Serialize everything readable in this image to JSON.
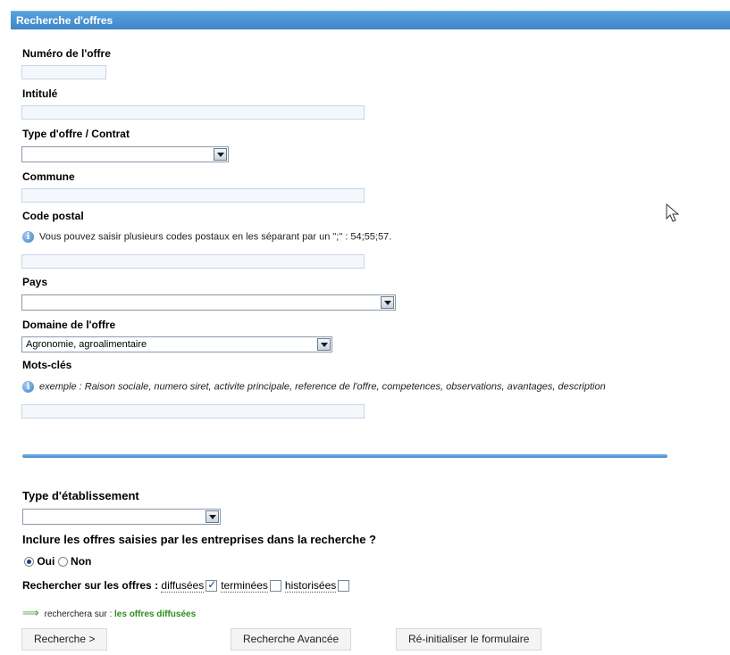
{
  "header": {
    "title": "Recherche d'offres"
  },
  "fields": {
    "numero": {
      "label": "Numéro de l'offre",
      "value": ""
    },
    "intitule": {
      "label": "Intitulé",
      "value": ""
    },
    "type_offre": {
      "label": "Type d'offre / Contrat",
      "selected": ""
    },
    "commune": {
      "label": "Commune",
      "value": ""
    },
    "code_postal": {
      "label": "Code postal",
      "value": "",
      "hint": "Vous pouvez saisir plusieurs codes postaux en les séparant par un \";\" : 54;55;57."
    },
    "pays": {
      "label": "Pays",
      "selected": ""
    },
    "domaine": {
      "label": "Domaine de l'offre",
      "selected": "Agronomie, agroalimentaire"
    },
    "mots_cles": {
      "label": "Mots-clés",
      "value": "",
      "hint": "exemple : Raison sociale, numero siret, activite principale, reference de l'offre, competences, observations, avantages, description"
    },
    "type_etab": {
      "label": "Type d'établissement",
      "selected": ""
    },
    "inclure": {
      "label": "Inclure les offres saisies par les entreprises dans la recherche ?",
      "oui": "Oui",
      "non": "Non",
      "selected": "Oui"
    },
    "rechercher_sur": {
      "label": "Rechercher sur les offres :",
      "options": [
        {
          "label": "diffusées",
          "checked": true
        },
        {
          "label": "terminées",
          "checked": false
        },
        {
          "label": "historisées",
          "checked": false
        }
      ]
    },
    "note": {
      "prefix": "recherchera sur :",
      "value": "les offres diffusées"
    }
  },
  "buttons": {
    "search": "Recherche >",
    "advanced": "Recherche Avancée",
    "reset": "Ré-initialiser le formulaire"
  },
  "icons": {
    "info": "info-icon",
    "arrow": "right-arrow-icon",
    "cursor": "mouse-cursor-icon"
  },
  "colors": {
    "header": "#3d86c8",
    "separator": "#3f86cf",
    "note_green": "#2e8b21"
  }
}
